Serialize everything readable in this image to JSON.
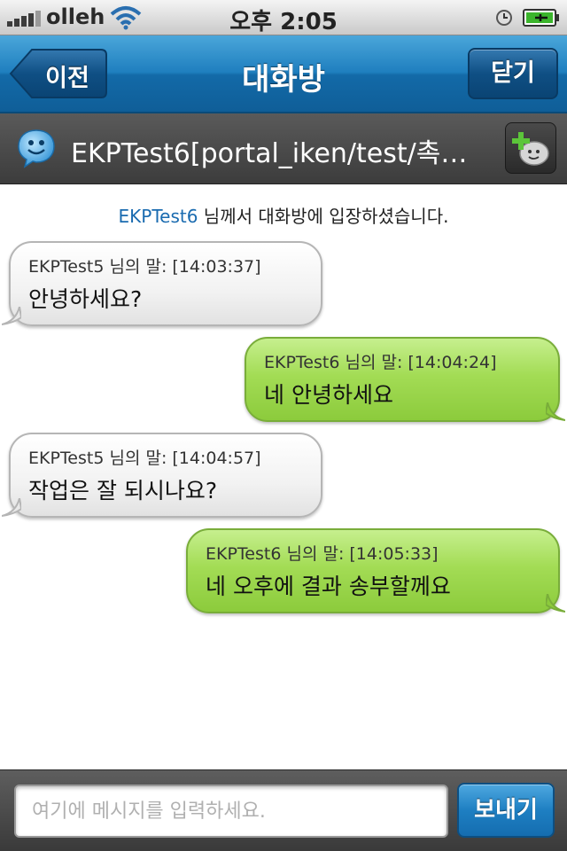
{
  "status_bar": {
    "carrier": "olleh",
    "time": "오후 2:05",
    "icons": [
      "signal-bars-icon",
      "wifi-icon",
      "alarm-clock-icon",
      "battery-charging-icon"
    ]
  },
  "nav": {
    "back_label": "이전",
    "title": "대화방",
    "close_label": "닫기"
  },
  "room": {
    "title": "EKPTest6[portal_iken/test/촉…",
    "icons": [
      "chat-smiley-icon",
      "add-participant-icon"
    ]
  },
  "chat": {
    "notice": {
      "user": "EKPTest6",
      "text": " 님께서 대화방에 입장하셨습니다."
    },
    "messages": [
      {
        "side": "left",
        "meta": "EKPTest5 님의 말: [14:03:37]",
        "text": "안녕하세요?"
      },
      {
        "side": "right",
        "meta": "EKPTest6 님의 말: [14:04:24]",
        "text": "네 안녕하세요"
      },
      {
        "side": "left",
        "meta": "EKPTest5 님의 말: [14:04:57]",
        "text": "작업은 잘 되시나요?"
      },
      {
        "side": "right",
        "meta": "EKPTest6 님의 말: [14:05:33]",
        "text": "네 오후에 결과 송부할께요"
      }
    ]
  },
  "input": {
    "placeholder": "여기에 메시지를 입력하세요.",
    "value": "",
    "send_label": "보내기"
  },
  "colors": {
    "nav_blue": "#1f7fbf",
    "notice_user": "#1a6bb0",
    "bubble_green": "#a3dc55",
    "bubble_white": "#f2f2f2"
  }
}
